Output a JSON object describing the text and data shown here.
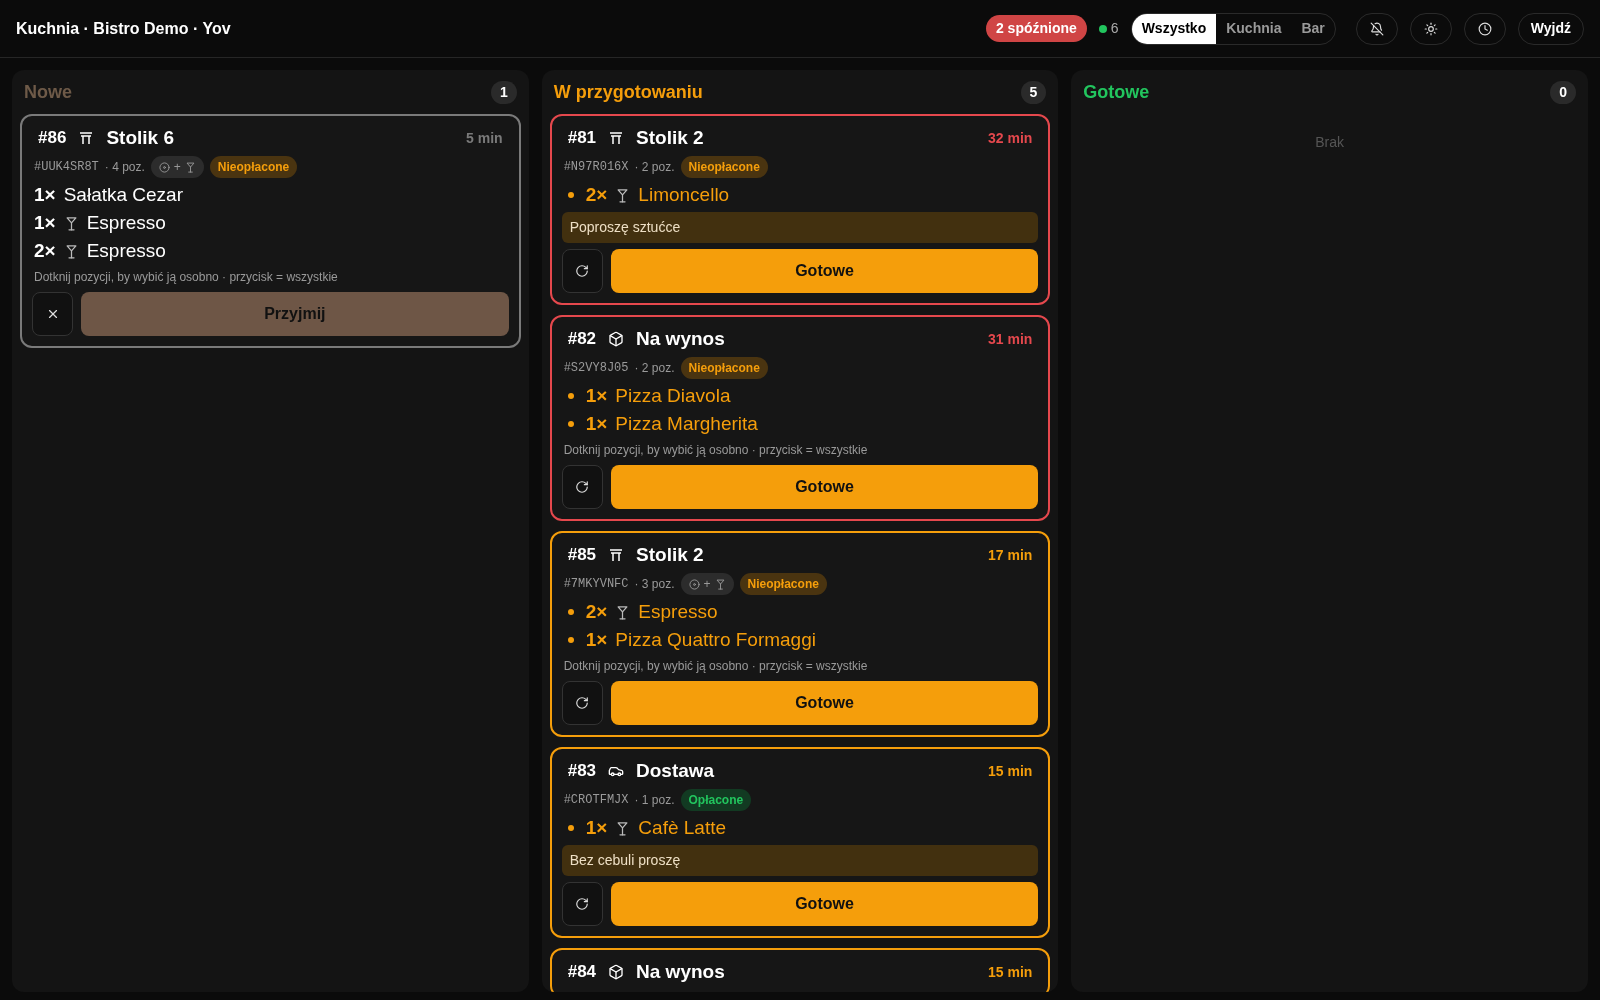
{
  "header": {
    "title": "Kuchnia · Bistro Demo · Yov",
    "late_badge": "2 spóźnione",
    "online": {
      "count": "6",
      "color": "#22c55e"
    },
    "tabs": [
      {
        "label": "Wszystko",
        "selected": true
      },
      {
        "label": "Kuchnia",
        "selected": false
      },
      {
        "label": "Bar",
        "selected": false
      }
    ],
    "icon_buttons": [
      {
        "kind": "bell-off"
      },
      {
        "kind": "sun"
      },
      {
        "kind": "clock"
      }
    ],
    "exit_button": "Wyjdź"
  },
  "columns": [
    {
      "title": "Nowe",
      "count": "1",
      "kind": "new",
      "orders": [
        {
          "number": "#86",
          "kind": "table",
          "place": "Stolik 6",
          "elapsed": "5 min",
          "color": "#7a7a7a",
          "code": "#UUK4SR8T",
          "positions": "· 4 poz.",
          "stations": {
            "joiner": "+"
          },
          "payment": {
            "kind": "unpaid",
            "label": "Nieopłacone"
          },
          "items": [
            {
              "qty": "1×",
              "name": "Sałatka Cezar",
              "drink": false
            },
            {
              "qty": "1×",
              "name": "Espresso",
              "drink": true
            },
            {
              "qty": "2×",
              "name": "Espresso",
              "drink": true
            }
          ],
          "hint": "Dotknij pozycji, by wybić ją osobno · przycisk = wszystkie",
          "action": "Przyjmij"
        }
      ]
    },
    {
      "title": "W przygotowaniu",
      "count": "5",
      "kind": "progress",
      "orders": [
        {
          "number": "#81",
          "kind": "table",
          "place": "Stolik 2",
          "elapsed": "32 min",
          "color": "#e5484d",
          "code": "#N97R016X",
          "positions": "· 2 poz.",
          "payment": {
            "kind": "unpaid",
            "label": "Nieopłacone"
          },
          "items": [
            {
              "qty": "2×",
              "name": "Limoncello",
              "drink": true
            }
          ],
          "note": "Poproszę sztućce",
          "action": "Gotowe"
        },
        {
          "number": "#82",
          "kind": "takeaway",
          "place": "Na wynos",
          "elapsed": "31 min",
          "color": "#e5484d",
          "code": "#S2VY8J05",
          "positions": "· 2 poz.",
          "payment": {
            "kind": "unpaid",
            "label": "Nieopłacone"
          },
          "items": [
            {
              "qty": "1×",
              "name": "Pizza Diavola",
              "drink": false
            },
            {
              "qty": "1×",
              "name": "Pizza Margherita",
              "drink": false
            }
          ],
          "hint": "Dotknij pozycji, by wybić ją osobno · przycisk = wszystkie",
          "action": "Gotowe"
        },
        {
          "number": "#85",
          "kind": "table",
          "place": "Stolik 2",
          "elapsed": "17 min",
          "color": "#f59e0b",
          "code": "#7MKYVNFC",
          "positions": "· 3 poz.",
          "stations": {
            "joiner": "+"
          },
          "payment": {
            "kind": "unpaid",
            "label": "Nieopłacone"
          },
          "items": [
            {
              "qty": "2×",
              "name": "Espresso",
              "drink": true
            },
            {
              "qty": "1×",
              "name": "Pizza Quattro Formaggi",
              "drink": false
            }
          ],
          "hint": "Dotknij pozycji, by wybić ją osobno · przycisk = wszystkie",
          "action": "Gotowe"
        },
        {
          "number": "#83",
          "kind": "delivery",
          "place": "Dostawa",
          "elapsed": "15 min",
          "color": "#f59e0b",
          "code": "#CROTFMJX",
          "positions": "· 1 poz.",
          "payment": {
            "kind": "paid",
            "label": "Opłacone"
          },
          "items": [
            {
              "qty": "1×",
              "name": "Cafè Latte",
              "drink": true
            }
          ],
          "note": "Bez cebuli proszę",
          "action": "Gotowe"
        },
        {
          "number": "#84",
          "kind": "takeaway",
          "place": "Na wynos",
          "elapsed": "15 min",
          "color": "#f59e0b"
        }
      ]
    },
    {
      "title": "Gotowe",
      "count": "0",
      "kind": "done",
      "empty": "Brak"
    }
  ]
}
